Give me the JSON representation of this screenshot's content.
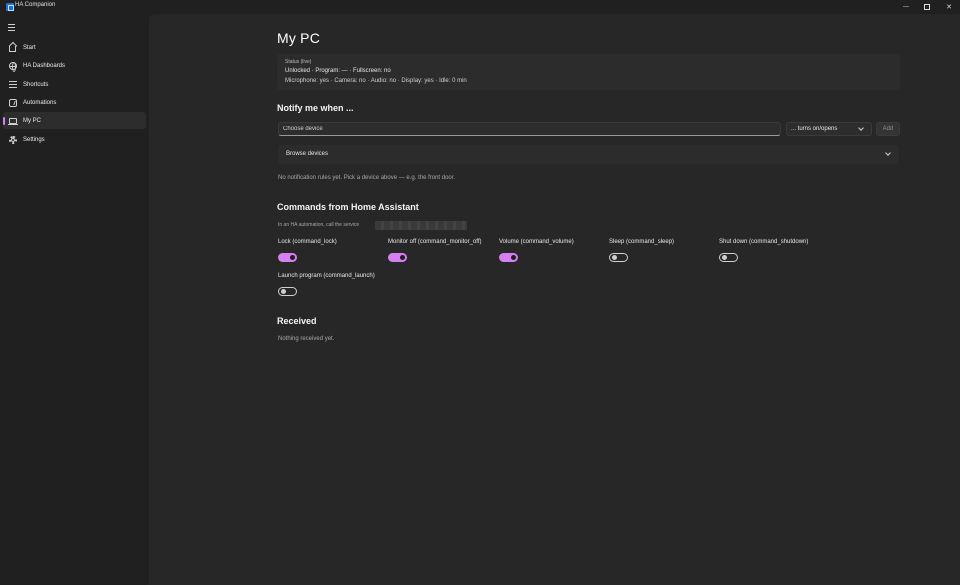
{
  "window": {
    "title": "HA Companion",
    "controls": {
      "minimize": "—",
      "close": "✕"
    }
  },
  "sidebar": {
    "items": [
      {
        "label": "Start",
        "icon": "home-icon",
        "selected": false
      },
      {
        "label": "HA Dashboards",
        "icon": "globe-icon",
        "selected": false
      },
      {
        "label": "Shortcuts",
        "icon": "list-icon",
        "selected": false
      },
      {
        "label": "Automations",
        "icon": "automation-icon",
        "selected": false
      },
      {
        "label": "My PC",
        "icon": "laptop-icon",
        "selected": true
      },
      {
        "label": "Settings",
        "icon": "gear-icon",
        "selected": false
      }
    ]
  },
  "page": {
    "title": "My PC",
    "status": {
      "label": "Status (live)",
      "line1": "Unlocked · Program: — · Fullscreen: no",
      "line2": "Microphone: yes · Camera: no · Audio: no · Display: yes · Idle: 0 min"
    },
    "notify": {
      "heading": "Notify me when ...",
      "device_placeholder": "Choose device",
      "trigger_value": "... turns on/opens",
      "add_label": "Add",
      "browse_label": "Browse devices",
      "empty_text": "No notification rules yet. Pick a device above — e.g. the front door."
    },
    "commands": {
      "heading": "Commands from Home Assistant",
      "service_hint": "In an HA automation, call the service",
      "items": [
        {
          "label": "Lock (command_lock)",
          "enabled": true
        },
        {
          "label": "Monitor off (command_monitor_off)",
          "enabled": true
        },
        {
          "label": "Volume (command_volume)",
          "enabled": true
        },
        {
          "label": "Sleep (command_sleep)",
          "enabled": false
        },
        {
          "label": "Shut down (command_shutdown)",
          "enabled": false
        },
        {
          "label": "Launch program (command_launch)",
          "enabled": false
        }
      ]
    },
    "received": {
      "heading": "Received",
      "empty_text": "Nothing received yet."
    }
  },
  "colors": {
    "accent": "#d57ff0",
    "background": "#202020",
    "content_background": "#272727",
    "card_background": "#2c2c2c"
  }
}
